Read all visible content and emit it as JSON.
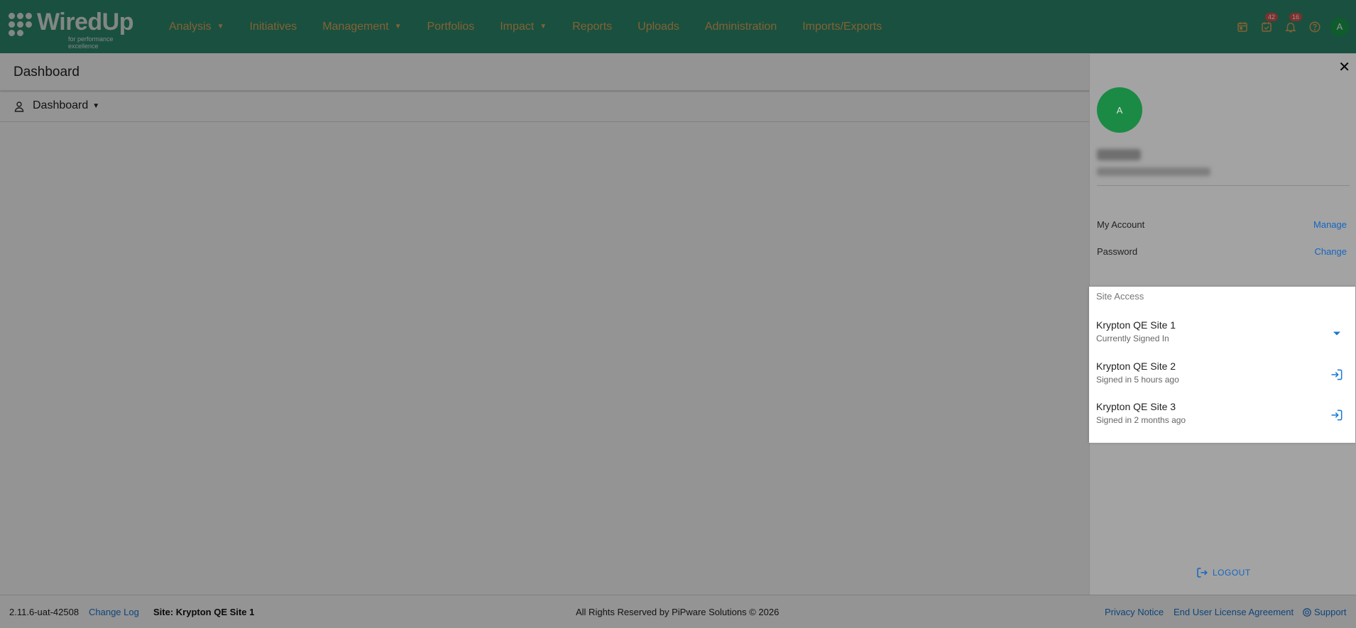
{
  "app": {
    "logo_text": "WiredUp",
    "logo_tagline": "for performance excellence"
  },
  "nav": {
    "items": [
      {
        "label": "Analysis",
        "has_caret": true
      },
      {
        "label": "Initiatives",
        "has_caret": false
      },
      {
        "label": "Management",
        "has_caret": true
      },
      {
        "label": "Portfolios",
        "has_caret": false
      },
      {
        "label": "Impact",
        "has_caret": true
      },
      {
        "label": "Reports",
        "has_caret": false
      },
      {
        "label": "Uploads",
        "has_caret": false
      },
      {
        "label": "Administration",
        "has_caret": false
      },
      {
        "label": "Imports/Exports",
        "has_caret": false
      }
    ],
    "tasks_badge": "42",
    "notifications_badge": "16",
    "user_initial": "A"
  },
  "page": {
    "title": "Dashboard",
    "dashboard_dropdown": "Dashboard"
  },
  "user_panel": {
    "avatar_initial": "A",
    "my_account_label": "My Account",
    "my_account_action": "Manage",
    "password_label": "Password",
    "password_action": "Change",
    "site_access_heading": "Site Access",
    "sites": [
      {
        "name": "Krypton QE Site 1",
        "status": "Currently Signed In"
      },
      {
        "name": "Krypton QE Site 2",
        "status": "Signed in 5 hours ago"
      },
      {
        "name": "Krypton QE Site 3",
        "status": "Signed in 2 months ago"
      }
    ],
    "logout_label": "LOGOUT"
  },
  "footer": {
    "version": "2.11.6-uat-42508",
    "change_log": "Change Log",
    "site_label": "Site: Krypton QE Site 1",
    "copyright": "All Rights Reserved by PiPware Solutions © 2026",
    "privacy": "Privacy Notice",
    "eula": "End User License Agreement",
    "support": "Support"
  },
  "colors": {
    "topbar_bg": "#2e8b6e",
    "nav_text": "#e0a95a",
    "link_blue": "#1976d2",
    "avatar_green": "#1b8a44",
    "badge_red": "#d9534f"
  }
}
